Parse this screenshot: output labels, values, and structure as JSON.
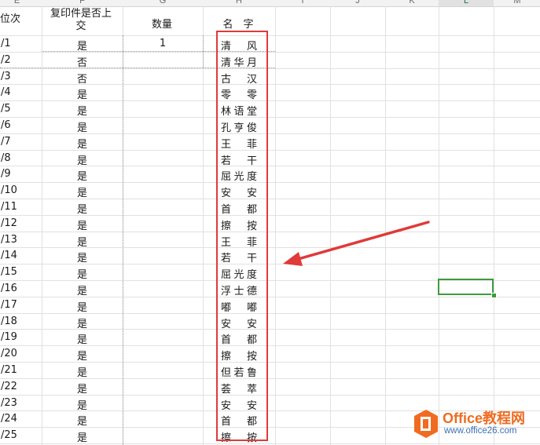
{
  "column_headers": [
    "E",
    "F",
    "G",
    "H",
    "I",
    "J",
    "K",
    "L",
    "M"
  ],
  "selected_column": "L",
  "header_row": {
    "e": "位次",
    "f_line1": "复印件是否上",
    "f_line2": "交",
    "g": "数量",
    "h": "名　字"
  },
  "rows": [
    {
      "e": "/1",
      "f": "是",
      "g": "1",
      "h": "清　风"
    },
    {
      "e": "/2",
      "f": "否",
      "g": "",
      "h": "清华月"
    },
    {
      "e": "/3",
      "f": "否",
      "g": "",
      "h": "古　汉"
    },
    {
      "e": "/4",
      "f": "是",
      "g": "",
      "h": "零　零"
    },
    {
      "e": "/5",
      "f": "是",
      "g": "",
      "h": "林语堂"
    },
    {
      "e": "/6",
      "f": "是",
      "g": "",
      "h": "孔亨俊"
    },
    {
      "e": "/7",
      "f": "是",
      "g": "",
      "h": "王　菲"
    },
    {
      "e": "/8",
      "f": "是",
      "g": "",
      "h": "若　干"
    },
    {
      "e": "/9",
      "f": "是",
      "g": "",
      "h": "屈光度"
    },
    {
      "e": "/10",
      "f": "是",
      "g": "",
      "h": "安　安"
    },
    {
      "e": "/11",
      "f": "是",
      "g": "",
      "h": "首　都"
    },
    {
      "e": "/12",
      "f": "是",
      "g": "",
      "h": "擦　按"
    },
    {
      "e": "/13",
      "f": "是",
      "g": "",
      "h": "王　菲"
    },
    {
      "e": "/14",
      "f": "是",
      "g": "",
      "h": "若　干"
    },
    {
      "e": "/15",
      "f": "是",
      "g": "",
      "h": "屈光度"
    },
    {
      "e": "/16",
      "f": "是",
      "g": "",
      "h": "浮士德"
    },
    {
      "e": "/17",
      "f": "是",
      "g": "",
      "h": "嘟　嘟"
    },
    {
      "e": "/18",
      "f": "是",
      "g": "",
      "h": "安　安"
    },
    {
      "e": "/19",
      "f": "是",
      "g": "",
      "h": "首　都"
    },
    {
      "e": "/20",
      "f": "是",
      "g": "",
      "h": "擦　按"
    },
    {
      "e": "/21",
      "f": "是",
      "g": "",
      "h": "但若鲁"
    },
    {
      "e": "/22",
      "f": "是",
      "g": "",
      "h": "荟　萃"
    },
    {
      "e": "/23",
      "f": "是",
      "g": "",
      "h": "安　安"
    },
    {
      "e": "/24",
      "f": "是",
      "g": "",
      "h": "首　都"
    },
    {
      "e": "/25",
      "f": "是",
      "g": "",
      "h": "擦　按"
    }
  ],
  "annotation": {
    "box_color": "#e03a3a",
    "arrow_color": "#e03a3a"
  },
  "selection_color": "#3f9a3f",
  "watermark": {
    "title": "Office教程网",
    "url": "www.office26.com",
    "logo_color": "#f06b21"
  }
}
